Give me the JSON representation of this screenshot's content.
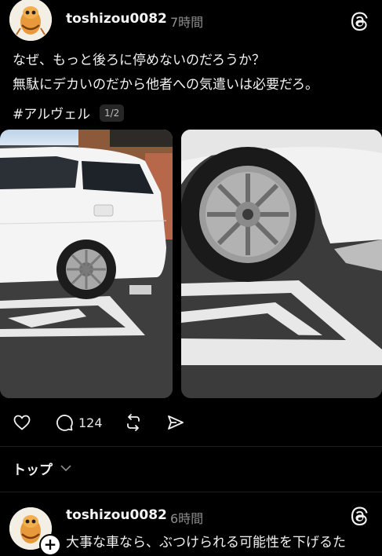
{
  "post1": {
    "username": "toshizou0082",
    "timestamp": "7時間",
    "caption_line1": "なぜ、もっと後ろに停めないのだろうか？",
    "caption_line2": "無駄にデカいのだから他者への気遣いは必要だろ。",
    "hashtag": "#アルヴェル",
    "image_counter": "1/2",
    "reply_count": "124",
    "icons": [
      "heart-icon",
      "comment-icon",
      "repost-icon",
      "share-icon",
      "threads-logo-icon"
    ]
  },
  "section": {
    "label": "トップ",
    "icon": "chevron-down-icon"
  },
  "post2": {
    "username": "toshizou0082",
    "timestamp": "6時間",
    "caption": "大事な車なら、ぶつけられる可能性を下げるた",
    "follow_plus": "+"
  },
  "colors": {
    "background": "#000000",
    "text": "#f3f3f3",
    "muted": "#8e8e8e",
    "counter_bg": "#262626"
  }
}
